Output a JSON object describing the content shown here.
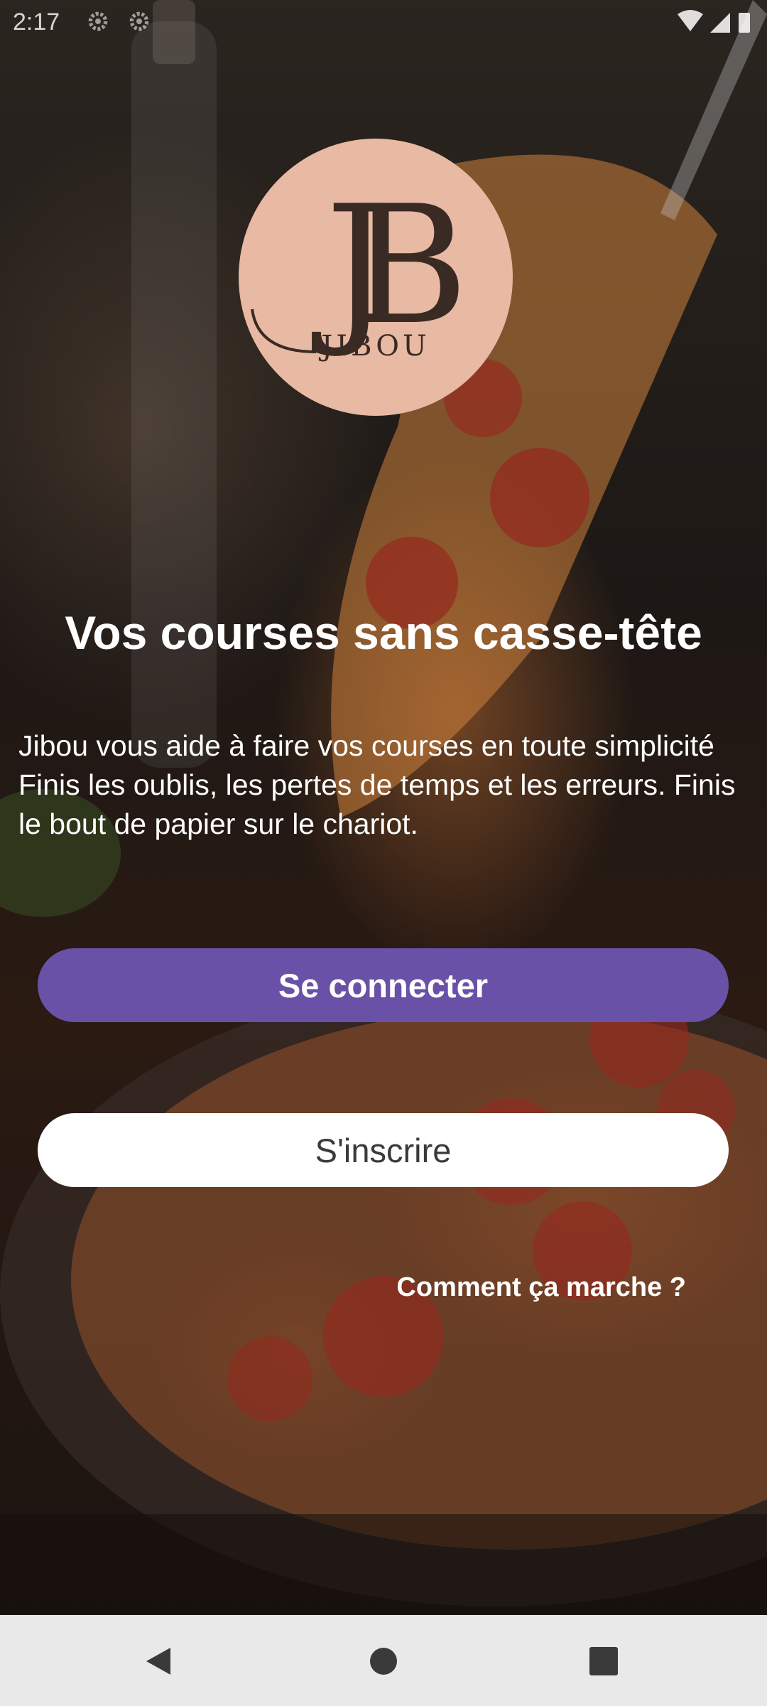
{
  "status_bar": {
    "time": "2:17",
    "icons": [
      "settings-icon",
      "settings-icon",
      "wifi-icon",
      "signal-icon",
      "battery-icon"
    ]
  },
  "logo": {
    "monogram": "JB",
    "wordmark": "JIBOU",
    "circle_color": "#e8b9a3",
    "letter_color": "#3a2a24"
  },
  "hero": {
    "headline": "Vos courses sans casse-tête",
    "description": "Jibou vous aide à faire vos courses en toute simplicité\n Finis les oublis, les pertes de temps et les erreurs. Finis le bout de papier sur le chariot."
  },
  "actions": {
    "login_label": "Se connecter",
    "signup_label": "S'inscrire",
    "help_link": "Comment ça marche ?"
  },
  "colors": {
    "primary_button": "#6a51a8",
    "secondary_button": "#ffffff",
    "nav_bar": "#e9e9e9"
  },
  "nav_bar": {
    "buttons": [
      "back-icon",
      "home-icon",
      "recents-icon"
    ]
  }
}
